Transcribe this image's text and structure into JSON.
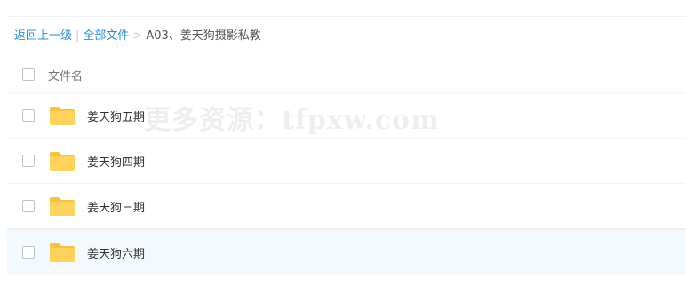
{
  "breadcrumb": {
    "back_label": "返回上一级",
    "separator": "|",
    "all_files_label": "全部文件",
    "chevron": ">",
    "current_folder": "A03、姜天狗摄影私教"
  },
  "list": {
    "header_label": "文件名",
    "items": [
      {
        "name": "姜天狗五期",
        "icon": "folder-icon"
      },
      {
        "name": "姜天狗四期",
        "icon": "folder-icon"
      },
      {
        "name": "姜天狗三期",
        "icon": "folder-icon"
      },
      {
        "name": "姜天狗六期",
        "icon": "folder-icon"
      }
    ]
  },
  "watermark": "更多资源：tfpxw.com",
  "colors": {
    "link": "#2a8fd6",
    "folder": "#ffd25c",
    "folder_tab": "#f5c242",
    "row_highlight": "#f4f9fd"
  }
}
